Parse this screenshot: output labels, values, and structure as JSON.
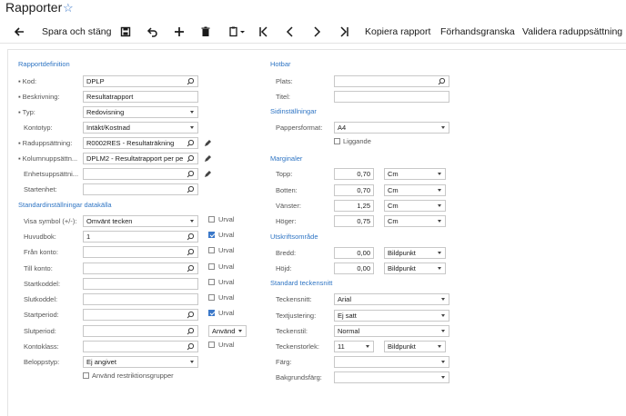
{
  "app": {
    "title": "Rapporter"
  },
  "toolbar": {
    "save_close": "Spara och stäng",
    "copy_report": "Kopiera rapport",
    "preview": "Förhandsgranska",
    "validate": "Validera raduppsättning"
  },
  "left": {
    "section_def": "Rapportdefinition",
    "kod_label": "Kod:",
    "kod_value": "DPLP",
    "beskrivning_label": "Beskrivning:",
    "beskrivning_value": "Resultatrapport",
    "typ_label": "Typ:",
    "typ_value": "Redovisning",
    "kontotyp_label": "Kontotyp:",
    "kontotyp_value": "Intäkt/Kostnad",
    "rad_label": "Raduppsättning:",
    "rad_value": "R0002RES - Resultaträkning",
    "kol_label": "Kolumnuppsättn...",
    "kol_value": "DPLM2 - Resultatrapport per pe",
    "enhet_label": "Enhetsuppsättni...",
    "enhet_value": "",
    "startenhet_label": "Startenhet:",
    "startenhet_value": "",
    "section_std": "Standardinställningar datakälla",
    "visa_label": "Visa symbol (+/-):",
    "visa_value": "Omvänt tecken",
    "huvudbok_label": "Huvudbok:",
    "huvudbok_value": "1",
    "fran_label": "Från konto:",
    "till_label": "Till konto:",
    "startkod_label": "Startkoddel:",
    "slutkod_label": "Slutkoddel:",
    "startper_label": "Startperiod:",
    "slutper_label": "Slutperiod:",
    "kontoklass_label": "Kontoklass:",
    "belopp_label": "Beloppstyp:",
    "belopp_value": "Ej angivet",
    "anvand_value": "Använd",
    "urval_label": "Urval",
    "restrik_label": "Använd restriktionsgrupper"
  },
  "right": {
    "section_hotbar": "Hotbar",
    "plats_label": "Plats:",
    "titel_label": "Titel:",
    "section_sida": "Sidinställningar",
    "papper_label": "Pappersformat:",
    "papper_value": "A4",
    "liggande_label": "Liggande",
    "section_marg": "Marginaler",
    "topp_label": "Topp:",
    "topp_value": "0,70",
    "botten_label": "Botten:",
    "botten_value": "0,70",
    "vanster_label": "Vänster:",
    "vanster_value": "1,25",
    "hoger_label": "Höger:",
    "hoger_value": "0,75",
    "unit_cm": "Cm",
    "section_utskrift": "Utskriftsområde",
    "bredd_label": "Bredd:",
    "bredd_value": "0,00",
    "hojd_label": "Höjd:",
    "hojd_value": "0,00",
    "unit_px": "Bildpunkt",
    "section_font": "Standard teckensnitt",
    "font_label": "Teckensnitt:",
    "font_value": "Arial",
    "align_label": "Textjustering:",
    "align_value": "Ej satt",
    "style_label": "Teckenstil:",
    "style_value": "Normal",
    "size_label": "Teckenstorlek:",
    "size_value": "11",
    "color_label": "Färg:",
    "bg_label": "Bakgrundsfärg:"
  },
  "checks": {
    "huvudbok_urval": true,
    "startper_urval": true,
    "liggande": false
  }
}
